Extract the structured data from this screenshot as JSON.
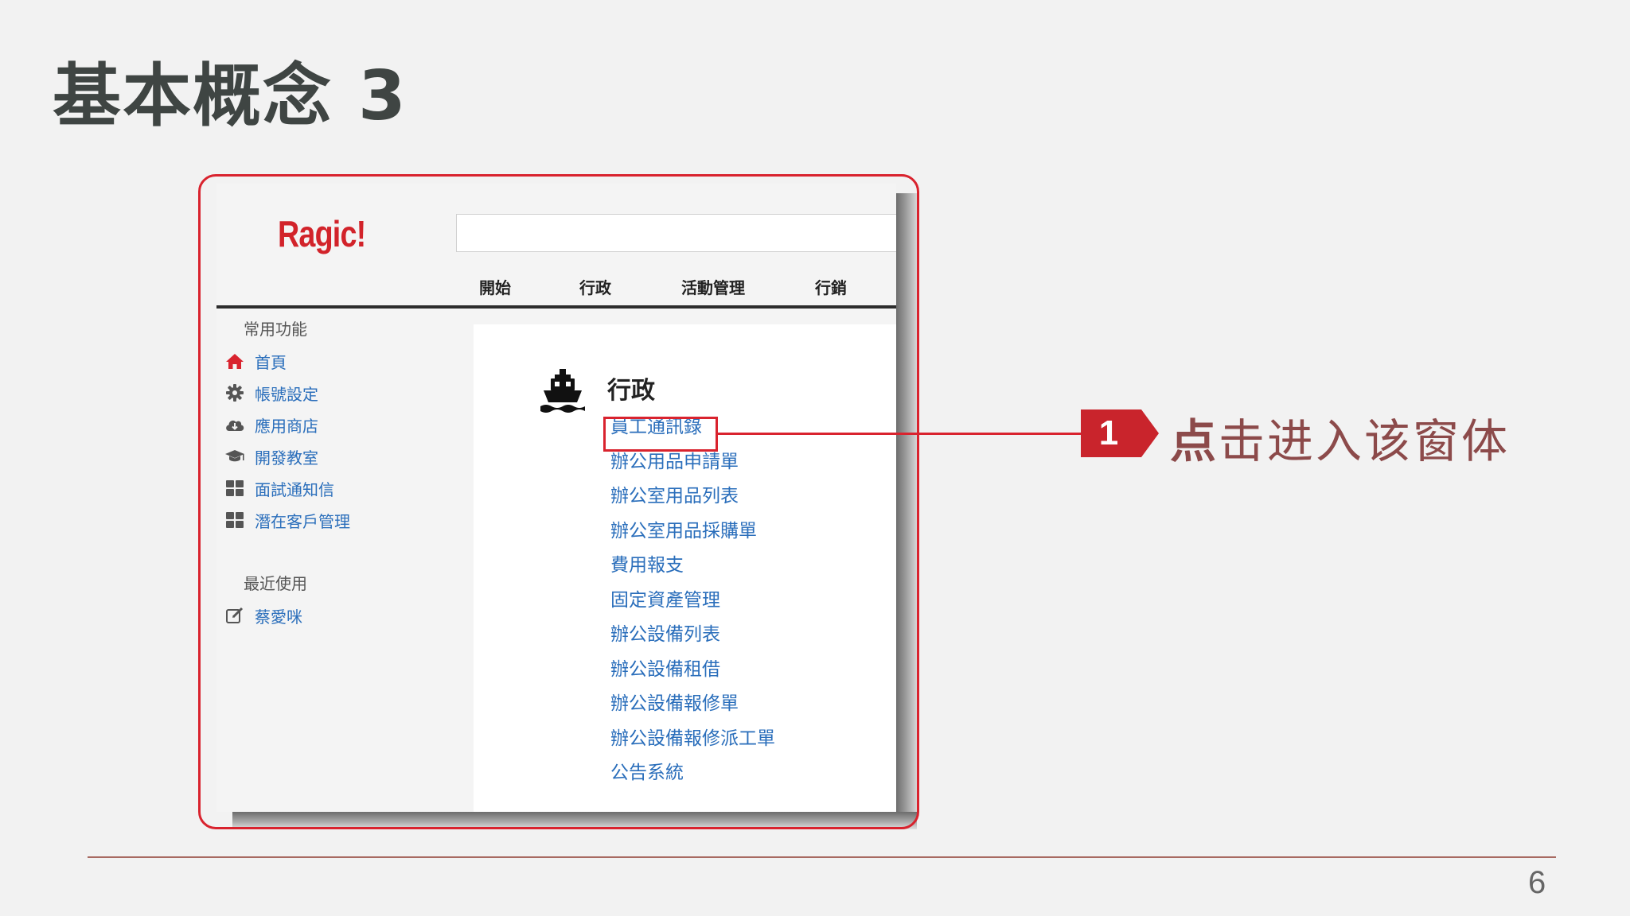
{
  "slide": {
    "title": "基本概念 3",
    "page_number": "6"
  },
  "app": {
    "logo": "Ragic!",
    "search": {
      "value": "",
      "placeholder": ""
    },
    "tabs": [
      {
        "label": "開始"
      },
      {
        "label": "行政"
      },
      {
        "label": "活動管理"
      },
      {
        "label": "行銷"
      }
    ],
    "sidebar": {
      "common_heading": "常用功能",
      "common_items": [
        {
          "label": "首頁",
          "icon": "home-icon"
        },
        {
          "label": "帳號設定",
          "icon": "gear-icon"
        },
        {
          "label": "應用商店",
          "icon": "cloud-download-icon"
        },
        {
          "label": "開發教室",
          "icon": "graduation-cap-icon"
        },
        {
          "label": "面試通知信",
          "icon": "grid-icon"
        },
        {
          "label": "潛在客戶管理",
          "icon": "grid-icon"
        }
      ],
      "recent_heading": "最近使用",
      "recent_items": [
        {
          "label": "蔡愛咪",
          "icon": "edit-icon"
        }
      ]
    },
    "section": {
      "title": "行政",
      "icon": "ship-icon",
      "sheets": [
        {
          "label": "員工通訊錄"
        },
        {
          "label": "辦公用品申請單"
        },
        {
          "label": "辦公室用品列表"
        },
        {
          "label": "辦公室用品採購單"
        },
        {
          "label": "費用報支"
        },
        {
          "label": "固定資產管理"
        },
        {
          "label": "辦公設備列表"
        },
        {
          "label": "辦公設備租借"
        },
        {
          "label": "辦公設備報修單"
        },
        {
          "label": "辦公設備報修派工單"
        },
        {
          "label": "公告系統"
        }
      ]
    }
  },
  "callout": {
    "step": "1",
    "text_first": "点",
    "text_rest": "击进入该窗体"
  },
  "colors": {
    "accent_red": "#d9232e",
    "link_blue": "#2a6ebb",
    "logo_red": "#d2232a",
    "callout_text": "#8c4a4a"
  }
}
